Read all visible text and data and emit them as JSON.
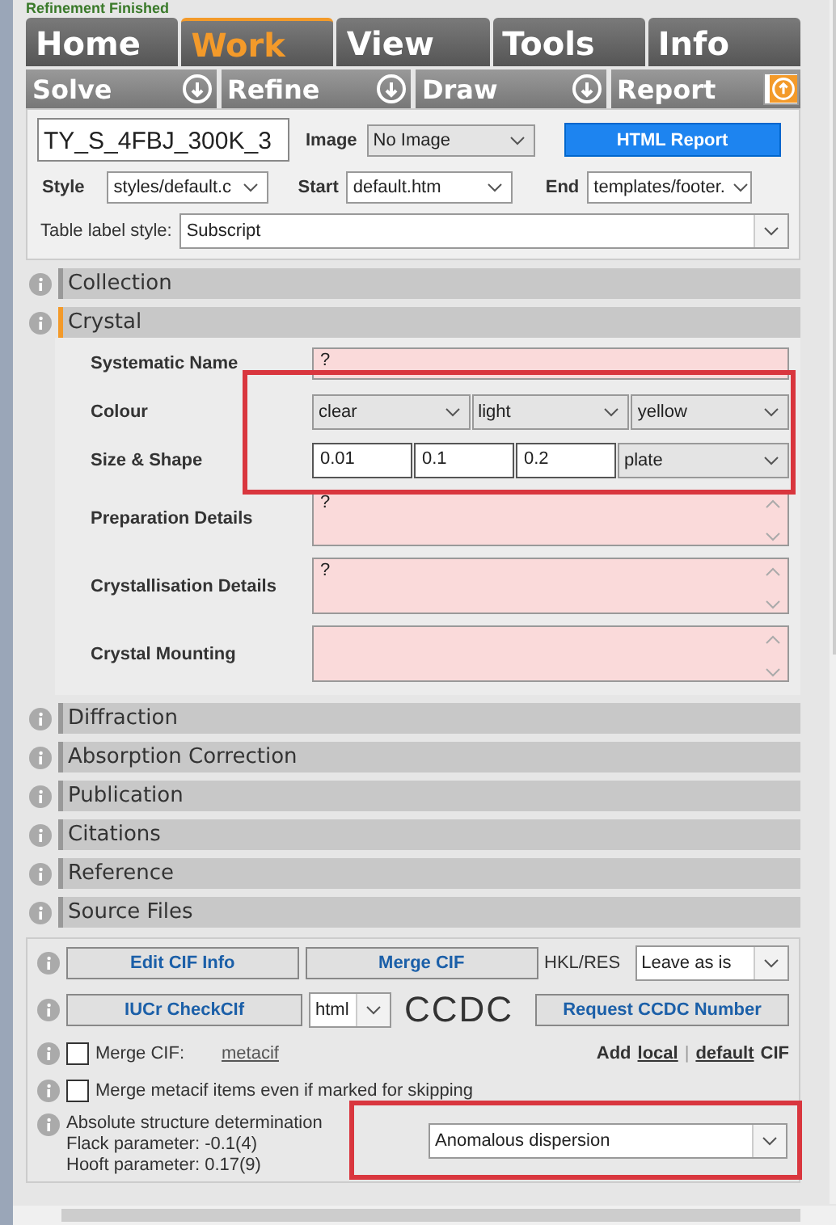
{
  "status": "Refinement Finished",
  "main_tabs": [
    {
      "label": "Home",
      "selected": false
    },
    {
      "label": "Work",
      "selected": true
    },
    {
      "label": "View",
      "selected": false
    },
    {
      "label": "Tools",
      "selected": false
    },
    {
      "label": "Info",
      "selected": false
    }
  ],
  "sub_tabs": [
    {
      "label": "Solve",
      "selected": false
    },
    {
      "label": "Refine",
      "selected": false
    },
    {
      "label": "Draw",
      "selected": false
    },
    {
      "label": "Report",
      "selected": true
    }
  ],
  "report_panel": {
    "file_name": "TY_S_4FBJ_300K_3",
    "image_label": "Image",
    "image_select": "No Image",
    "html_report_button": "HTML Report",
    "style_label": "Style",
    "style_select": "styles/default.c",
    "start_label": "Start",
    "start_select": "default.htm",
    "end_label": "End",
    "end_select": "templates/footer.",
    "table_label_style_label": "Table label style:",
    "table_label_style_select": "Subscript"
  },
  "sections_before": [
    {
      "title": "Collection",
      "expanded": false
    },
    {
      "title": "Crystal",
      "expanded": true
    }
  ],
  "crystal_fields": [
    {
      "label": "Systematic Name",
      "kind": "text",
      "value": "?"
    },
    {
      "label": "Colour",
      "kind": "selects",
      "values": [
        "clear",
        "light",
        "yellow"
      ]
    },
    {
      "label": "Size & Shape",
      "kind": "size",
      "values": [
        "0.01",
        "0.1",
        "0.2"
      ],
      "shape": "plate"
    },
    {
      "label": "Preparation Details",
      "kind": "textarea",
      "value": "?"
    },
    {
      "label": "Crystallisation Details",
      "kind": "textarea",
      "value": "?"
    },
    {
      "label": "Crystal Mounting",
      "kind": "textarea"
    }
  ],
  "sections_after": [
    {
      "title": "Diffraction",
      "expanded": false
    },
    {
      "title": "Absorption Correction",
      "expanded": false
    },
    {
      "title": "Publication",
      "expanded": false
    },
    {
      "title": "Citations",
      "expanded": false
    },
    {
      "title": "Reference",
      "expanded": false
    },
    {
      "title": "Source Files",
      "expanded": false
    }
  ],
  "cif_tools": {
    "edit_cif_button": "Edit CIF Info",
    "merge_cif_button": "Merge CIF",
    "hkl_res_label": "HKL/RES",
    "hkl_res_select": "Leave as is",
    "checkcif_button": "IUCr CheckCIf",
    "format_select": "html",
    "ccdc_logo": "CCDC",
    "request_ccdc_button": "Request CCDC Number",
    "merge_cif_checkbox": {
      "label": "Merge CIF:",
      "checked": false
    },
    "metacif_link": "metacif",
    "add_label": "Add",
    "local_link": "local",
    "separator": "|",
    "default_link": "default",
    "cif_label": "CIF",
    "merge_skipped_checkbox": {
      "label": "Merge metacif items even if marked for skipping",
      "checked": false
    },
    "absolute_structure_title": "Absolute structure determination",
    "flack_parameter": "Flack parameter: -0.1(4)",
    "hooft_parameter": "Hooft parameter: 0.17(9)",
    "absolute_structure_select": "Anomalous dispersion"
  }
}
